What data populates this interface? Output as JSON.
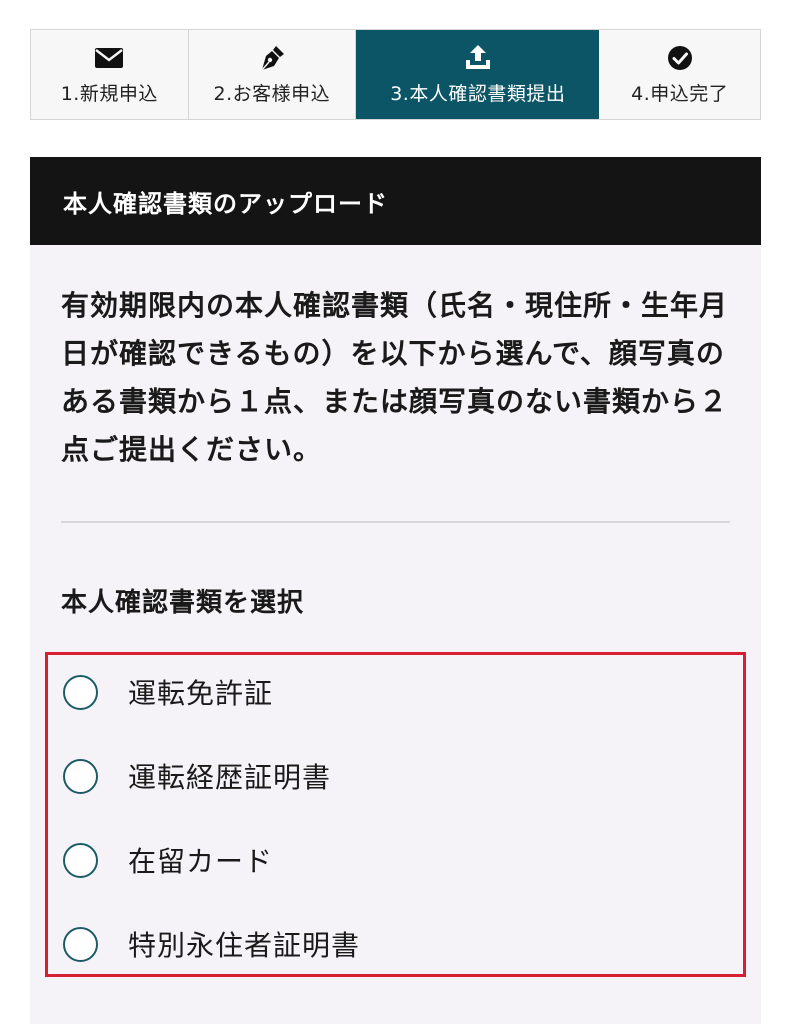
{
  "stepper": {
    "steps": [
      {
        "label": "1.新規申込",
        "icon": "envelope-icon",
        "active": false
      },
      {
        "label": "2.お客様申込",
        "icon": "pen-icon",
        "active": false
      },
      {
        "label": "3.本人確認書類提出",
        "icon": "upload-icon",
        "active": true
      },
      {
        "label": "4.申込完了",
        "icon": "check-circle-icon",
        "active": false
      }
    ]
  },
  "card": {
    "header": "本人確認書類のアップロード",
    "instructions": "有効期限内の本人確認書類（氏名・現住所・生年月日が確認できるもの）を以下から選んで、顔写真のある書類から１点、または顔写真のない書類から２点ご提出ください。",
    "section_title": "本人確認書類を選択",
    "options": [
      {
        "label": "運転免許証",
        "selected": false
      },
      {
        "label": "運転経歴証明書",
        "selected": false
      },
      {
        "label": "在留カード",
        "selected": false
      },
      {
        "label": "特別永住者証明書",
        "selected": false
      }
    ]
  },
  "colors": {
    "active_step": "#0b5566",
    "header_bg": "#141414",
    "highlight_border": "#d71f32",
    "radio_border": "#1c5b66"
  }
}
